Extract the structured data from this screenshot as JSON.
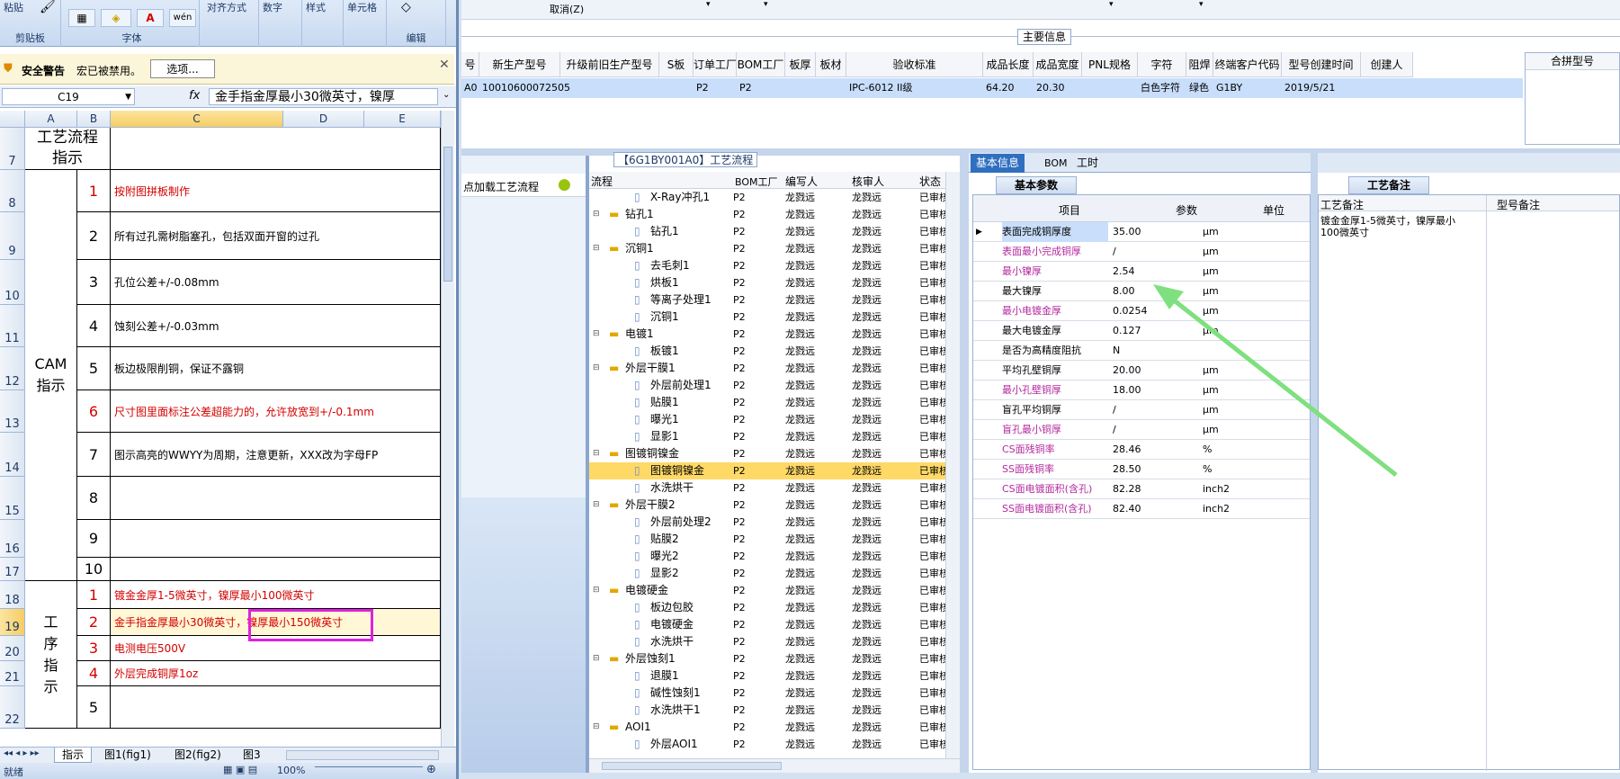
{
  "excel": {
    "ribbon": {
      "top_labels": [
        "粘贴",
        "对齐方式",
        "数字",
        "样式",
        "单元格"
      ],
      "groups": [
        "剪贴板",
        "字体",
        "编辑"
      ]
    },
    "security": {
      "title": "安全警告",
      "message": "宏已被禁用。",
      "options_button": "选项..."
    },
    "formula_bar": {
      "name_box": "C19",
      "fx": "fx",
      "content": "金手指金厚最小30微英寸，镍厚"
    },
    "columns": [
      "A",
      "B",
      "C",
      "D",
      "E"
    ],
    "rows": [
      {
        "rownum": "7"
      },
      {
        "rownum": "8"
      },
      {
        "rownum": "9"
      },
      {
        "rownum": "10"
      },
      {
        "rownum": "11"
      },
      {
        "rownum": "12"
      },
      {
        "rownum": "13"
      },
      {
        "rownum": "14"
      },
      {
        "rownum": "15"
      },
      {
        "rownum": "16"
      },
      {
        "rownum": "17"
      },
      {
        "rownum": "18"
      },
      {
        "rownum": "19"
      },
      {
        "rownum": "20"
      },
      {
        "rownum": "21"
      },
      {
        "rownum": "22"
      }
    ],
    "header_cell": "工艺流程指示",
    "cam_label": "CAM指示",
    "process_label": "工序指示",
    "cam_items": [
      {
        "n": "1",
        "text": "按附图拼板制作",
        "red": true
      },
      {
        "n": "2",
        "text": "所有过孔需树脂塞孔，包括双面开窗的过孔",
        "red": false
      },
      {
        "n": "3",
        "text": "孔位公差+/-0.08mm",
        "red": false
      },
      {
        "n": "4",
        "text": "蚀刻公差+/-0.03mm",
        "red": false
      },
      {
        "n": "5",
        "text": "板边极限削铜，保证不露铜",
        "red": false
      },
      {
        "n": "6",
        "text": "尺寸图里面标注公差超能力的，允许放宽到+/-0.1mm",
        "red": true
      },
      {
        "n": "7",
        "text": "图示高亮的WWYY为周期，注意更新，XXX改为字母FP",
        "red": false
      },
      {
        "n": "8",
        "text": "",
        "red": false
      },
      {
        "n": "9",
        "text": "",
        "red": false
      },
      {
        "n": "10",
        "text": "",
        "red": false
      }
    ],
    "process_items": [
      {
        "n": "1",
        "text": "镀金金厚1-5微英寸，镍厚最小100微英寸"
      },
      {
        "n": "2",
        "text": "金手指金厚最小30微英寸，镍厚最小150微英寸"
      },
      {
        "n": "3",
        "text": "电测电压500V"
      },
      {
        "n": "4",
        "text": "外层完成铜厚1oz"
      },
      {
        "n": "5",
        "text": ""
      }
    ],
    "sheet_tabs": [
      "指示",
      "图1(fig1)",
      "图2(fig2)",
      "图3"
    ],
    "status": {
      "mode": "就绪",
      "zoom": "100%"
    }
  },
  "erp": {
    "menu_undo": "取消(Z)",
    "main_info_title": "主要信息",
    "grid_headers": [
      "号",
      "新生产型号",
      "升级前旧生产型号",
      "S板",
      "订单工厂",
      "BOM工厂",
      "板厚",
      "板材",
      "验收标准",
      "成品长度",
      "成品宽度",
      "PNL规格",
      "字符",
      "阻焊",
      "终端客户代码",
      "型号创建时间",
      "创建人"
    ],
    "grid_row": [
      "A0",
      "10010600072505",
      "",
      "",
      "P2",
      "P2",
      "",
      "",
      "IPC-6012 II级",
      "64.20",
      "20.30",
      "",
      "白色字符",
      "绿色",
      "G1BY",
      "2019/5/21",
      ""
    ],
    "merge_title": "合拼型号",
    "left_panel_link": "点加载工艺流程",
    "process_title": "【6G1BY001A0】工艺流程",
    "tree_headers": [
      "流程",
      "BOM工厂",
      "编写人",
      "核审人",
      "状态"
    ],
    "tree_rows": [
      {
        "name": "X-Ray冲孔1",
        "level": 2,
        "f": "P2",
        "w": "龙戮远",
        "r": "龙戮远",
        "s": "已审核"
      },
      {
        "name": "钻孔1",
        "level": 1,
        "f": "P2",
        "w": "龙戮远",
        "r": "龙戮远",
        "s": "已审核"
      },
      {
        "name": "钻孔1",
        "level": 2,
        "f": "P2",
        "w": "龙戮远",
        "r": "龙戮远",
        "s": "已审核"
      },
      {
        "name": "沉铜1",
        "level": 1,
        "f": "P2",
        "w": "龙戮远",
        "r": "龙戮远",
        "s": "已审核"
      },
      {
        "name": "去毛刺1",
        "level": 2,
        "f": "P2",
        "w": "龙戮远",
        "r": "龙戮远",
        "s": "已审核"
      },
      {
        "name": "烘板1",
        "level": 2,
        "f": "P2",
        "w": "龙戮远",
        "r": "龙戮远",
        "s": "已审核"
      },
      {
        "name": "等离子处理1",
        "level": 2,
        "f": "P2",
        "w": "龙戮远",
        "r": "龙戮远",
        "s": "已审核"
      },
      {
        "name": "沉铜1",
        "level": 2,
        "f": "P2",
        "w": "龙戮远",
        "r": "龙戮远",
        "s": "已审核"
      },
      {
        "name": "电镀1",
        "level": 1,
        "f": "P2",
        "w": "龙戮远",
        "r": "龙戮远",
        "s": "已审核"
      },
      {
        "name": "板镀1",
        "level": 2,
        "f": "P2",
        "w": "龙戮远",
        "r": "龙戮远",
        "s": "已审核"
      },
      {
        "name": "外层干膜1",
        "level": 1,
        "f": "P2",
        "w": "龙戮远",
        "r": "龙戮远",
        "s": "已审核"
      },
      {
        "name": "外层前处理1",
        "level": 2,
        "f": "P2",
        "w": "龙戮远",
        "r": "龙戮远",
        "s": "已审核"
      },
      {
        "name": "贴膜1",
        "level": 2,
        "f": "P2",
        "w": "龙戮远",
        "r": "龙戮远",
        "s": "已审核"
      },
      {
        "name": "曝光1",
        "level": 2,
        "f": "P2",
        "w": "龙戮远",
        "r": "龙戮远",
        "s": "已审核"
      },
      {
        "name": "显影1",
        "level": 2,
        "f": "P2",
        "w": "龙戮远",
        "r": "龙戮远",
        "s": "已审核"
      },
      {
        "name": "图镀铜镍金",
        "level": 1,
        "f": "P2",
        "w": "龙戮远",
        "r": "龙戮远",
        "s": "已审核"
      },
      {
        "name": "图镀铜镍金",
        "level": 2,
        "f": "P2",
        "w": "龙戮远",
        "r": "龙戮远",
        "s": "已审核",
        "selected": true
      },
      {
        "name": "水洗烘干",
        "level": 2,
        "f": "P2",
        "w": "龙戮远",
        "r": "龙戮远",
        "s": "已审核"
      },
      {
        "name": "外层干膜2",
        "level": 1,
        "f": "P2",
        "w": "龙戮远",
        "r": "龙戮远",
        "s": "已审核"
      },
      {
        "name": "外层前处理2",
        "level": 2,
        "f": "P2",
        "w": "龙戮远",
        "r": "龙戮远",
        "s": "已审核"
      },
      {
        "name": "贴膜2",
        "level": 2,
        "f": "P2",
        "w": "龙戮远",
        "r": "龙戮远",
        "s": "已审核"
      },
      {
        "name": "曝光2",
        "level": 2,
        "f": "P2",
        "w": "龙戮远",
        "r": "龙戮远",
        "s": "已审核"
      },
      {
        "name": "显影2",
        "level": 2,
        "f": "P2",
        "w": "龙戮远",
        "r": "龙戮远",
        "s": "已审核"
      },
      {
        "name": "电镀硬金",
        "level": 1,
        "f": "P2",
        "w": "龙戮远",
        "r": "龙戮远",
        "s": "已审核"
      },
      {
        "name": "板边包胶",
        "level": 2,
        "f": "P2",
        "w": "龙戮远",
        "r": "龙戮远",
        "s": "已审核"
      },
      {
        "name": "电镀硬金",
        "level": 2,
        "f": "P2",
        "w": "龙戮远",
        "r": "龙戮远",
        "s": "已审核"
      },
      {
        "name": "水洗烘干",
        "level": 2,
        "f": "P2",
        "w": "龙戮远",
        "r": "龙戮远",
        "s": "已审核"
      },
      {
        "name": "外层蚀刻1",
        "level": 1,
        "f": "P2",
        "w": "龙戮远",
        "r": "龙戮远",
        "s": "已审核"
      },
      {
        "name": "退膜1",
        "level": 2,
        "f": "P2",
        "w": "龙戮远",
        "r": "龙戮远",
        "s": "已审核"
      },
      {
        "name": "碱性蚀刻1",
        "level": 2,
        "f": "P2",
        "w": "龙戮远",
        "r": "龙戮远",
        "s": "已审核"
      },
      {
        "name": "水洗烘干1",
        "level": 2,
        "f": "P2",
        "w": "龙戮远",
        "r": "龙戮远",
        "s": "已审核"
      },
      {
        "name": "AOI1",
        "level": 1,
        "f": "P2",
        "w": "龙戮远",
        "r": "龙戮远",
        "s": "已审核"
      },
      {
        "name": "外层AOI1",
        "level": 2,
        "f": "P2",
        "w": "龙戮远",
        "r": "龙戮远",
        "s": "已审核"
      }
    ],
    "right_tabs": [
      "基本信息",
      "BOM",
      "工时"
    ],
    "params_title": "基本参数",
    "param_headers": [
      "项目",
      "参数",
      "单位"
    ],
    "params": [
      {
        "item": "表面完成铜厚度",
        "value": "35.00",
        "unit": "μm",
        "purple": false,
        "highlight": true
      },
      {
        "item": "表面最小完成铜厚",
        "value": "/",
        "unit": "μm",
        "purple": true
      },
      {
        "item": "最小镍厚",
        "value": "2.54",
        "unit": "μm",
        "purple": true
      },
      {
        "item": "最大镍厚",
        "value": "8.00",
        "unit": "μm",
        "purple": false
      },
      {
        "item": "最小电镀金厚",
        "value": "0.0254",
        "unit": "μm",
        "purple": true
      },
      {
        "item": "最大电镀金厚",
        "value": "0.127",
        "unit": "μm",
        "purple": false
      },
      {
        "item": "是否为高精度阻抗",
        "value": "N",
        "unit": "",
        "purple": false
      },
      {
        "item": "平均孔壁铜厚",
        "value": "20.00",
        "unit": "μm",
        "purple": false
      },
      {
        "item": "最小孔壁铜厚",
        "value": "18.00",
        "unit": "μm",
        "purple": true
      },
      {
        "item": "盲孔平均铜厚",
        "value": "/",
        "unit": "μm",
        "purple": false
      },
      {
        "item": "盲孔最小铜厚",
        "value": "/",
        "unit": "μm",
        "purple": true
      },
      {
        "item": "CS面残铜率",
        "value": "28.46",
        "unit": "%",
        "purple": true
      },
      {
        "item": "SS面残铜率",
        "value": "28.50",
        "unit": "%",
        "purple": true
      },
      {
        "item": "CS面电镀面积(含孔)",
        "value": "82.28",
        "unit": "inch2",
        "purple": true
      },
      {
        "item": "SS面电镀面积(含孔)",
        "value": "82.40",
        "unit": "inch2",
        "purple": true
      }
    ],
    "remarks_title": "工艺备注",
    "remarks_col1": "工艺备注",
    "remarks_col2": "型号备注",
    "remarks_text": "镀金金厚1-5微英寸，镍厚最小100微英寸"
  },
  "colors": {
    "arrow": "#7ee07e",
    "highlight_box": "#e020e0",
    "red_text": "#d40000",
    "purple_text": "#b3299e",
    "selected_row": "#ffd966"
  }
}
